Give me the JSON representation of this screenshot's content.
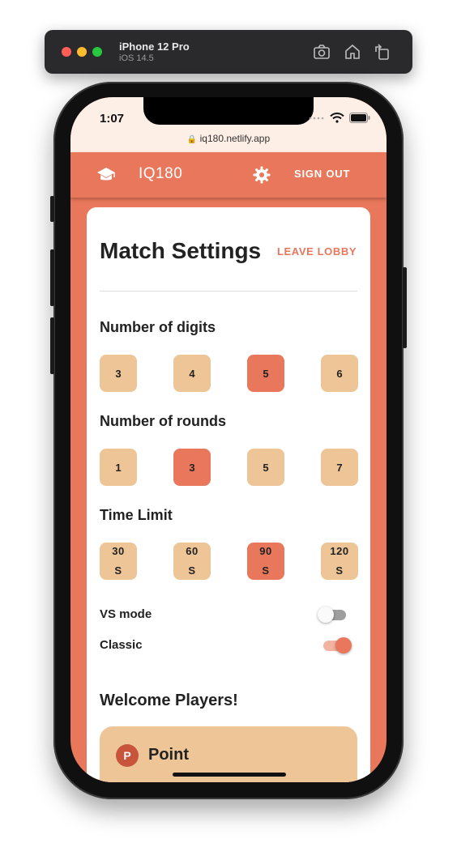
{
  "simulator": {
    "device": "iPhone 12 Pro",
    "os": "iOS 14.5"
  },
  "status_bar": {
    "time": "1:07",
    "url": "iq180.netlify.app"
  },
  "header": {
    "brand": "IQ180",
    "sign_out": "SIGN OUT"
  },
  "settings": {
    "title": "Match Settings",
    "leave_lobby": "LEAVE LOBBY",
    "digits": {
      "label": "Number of digits",
      "options": [
        "3",
        "4",
        "5",
        "6"
      ],
      "selected": "5"
    },
    "rounds": {
      "label": "Number of rounds",
      "options": [
        "1",
        "3",
        "5",
        "7"
      ],
      "selected": "3"
    },
    "time_limit": {
      "label": "Time Limit",
      "options": [
        {
          "value": "30",
          "unit": "S"
        },
        {
          "value": "60",
          "unit": "S"
        },
        {
          "value": "90",
          "unit": "S"
        },
        {
          "value": "120",
          "unit": "S"
        }
      ],
      "selected": "90"
    },
    "vs_mode": {
      "label": "VS mode",
      "on": false
    },
    "classic": {
      "label": "Classic",
      "on": true
    }
  },
  "players": {
    "heading": "Welcome Players!",
    "list": [
      {
        "initial": "P",
        "name": "Point"
      }
    ]
  },
  "colors": {
    "accent": "#e8775b",
    "option": "#edc597",
    "card": "#ffffff",
    "status_bg": "#fdeee6"
  }
}
